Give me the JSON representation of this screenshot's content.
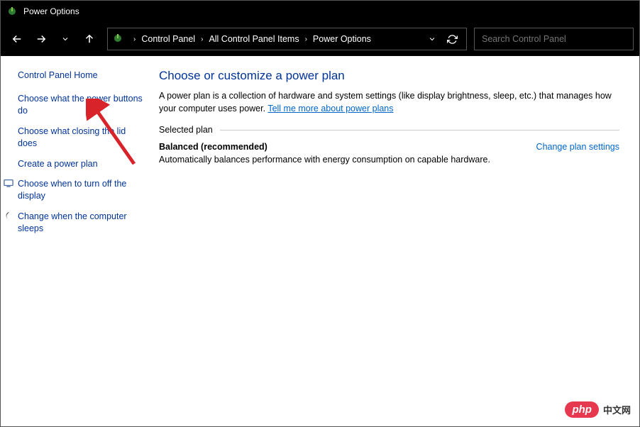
{
  "window": {
    "title": "Power Options"
  },
  "breadcrumb": {
    "a": "Control Panel",
    "b": "All Control Panel Items",
    "c": "Power Options"
  },
  "search": {
    "placeholder": "Search Control Panel"
  },
  "sidebar": {
    "home": "Control Panel Home",
    "items": [
      "Choose what the power buttons do",
      "Choose what closing the lid does",
      "Create a power plan",
      "Choose when to turn off the display",
      "Change when the computer sleeps"
    ]
  },
  "main": {
    "title": "Choose or customize a power plan",
    "desc_pre": "A power plan is a collection of hardware and system settings (like display brightness, sleep, etc.) that manages how your computer uses power. ",
    "desc_link": "Tell me more about power plans",
    "section_label": "Selected plan",
    "plan_name": "Balanced (recommended)",
    "plan_desc": "Automatically balances performance with energy consumption on capable hardware.",
    "change_link": "Change plan settings"
  },
  "watermark": {
    "logo": "php",
    "text": "中文网"
  }
}
